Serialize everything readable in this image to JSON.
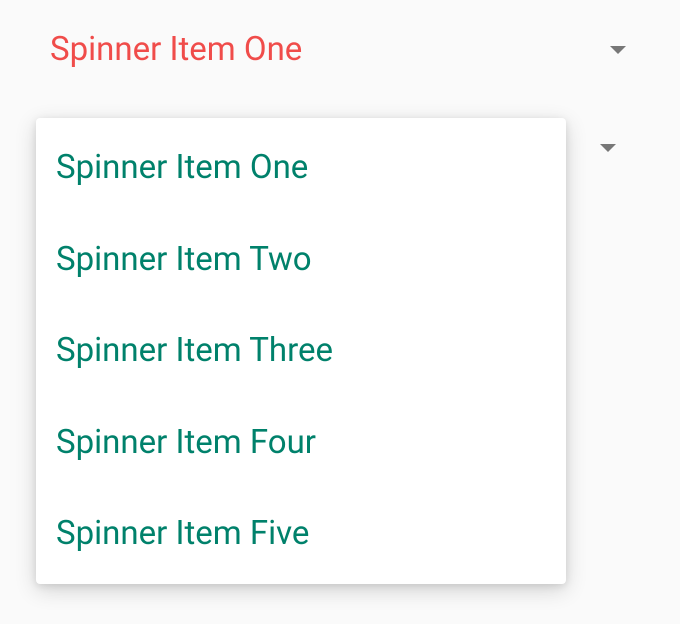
{
  "spinner": {
    "selected_label": "Spinner Item One",
    "colors": {
      "selected_text": "#f04c4a",
      "item_text": "#00816b"
    },
    "items": [
      {
        "label": "Spinner Item One"
      },
      {
        "label": "Spinner Item Two"
      },
      {
        "label": "Spinner Item Three"
      },
      {
        "label": "Spinner Item Four"
      },
      {
        "label": "Spinner Item Five"
      }
    ]
  }
}
